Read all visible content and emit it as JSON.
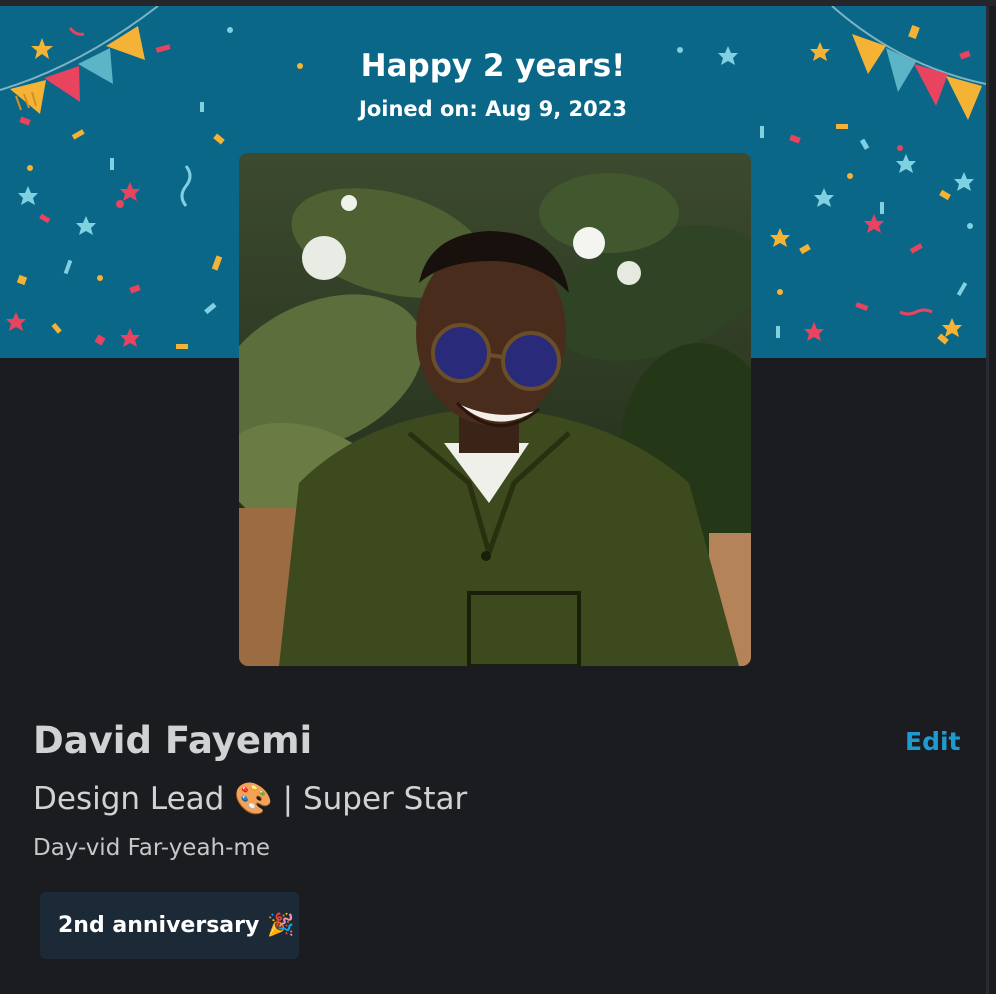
{
  "banner": {
    "headline": "Happy 2 years!",
    "subline": "Joined on: Aug 9, 2023",
    "background_color": "#0b6788"
  },
  "profile": {
    "name": "David Fayemi",
    "edit_label": "Edit",
    "title": "Design Lead 🎨 | Super Star",
    "pronunciation": "Day-vid Far-yeah-me",
    "badge_label": "2nd anniversary 🎉",
    "accent_color": "#1d9bd1"
  },
  "icons": {
    "bunting_left": "bunting-flags-icon",
    "bunting_right": "bunting-flags-icon",
    "confetti": "confetti-decoration"
  }
}
